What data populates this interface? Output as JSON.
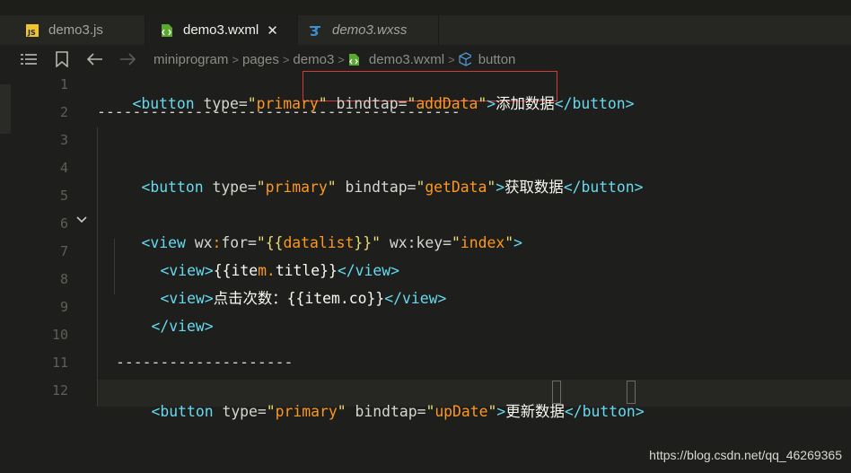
{
  "tabs": [
    {
      "label": "demo3.js",
      "icon": "js-file-icon",
      "active": false,
      "italic": false
    },
    {
      "label": "demo3.wxml",
      "icon": "wxml-file-icon",
      "active": true,
      "italic": false,
      "close": "✕"
    },
    {
      "label": "demo3.wxss",
      "icon": "css-file-icon",
      "active": false,
      "italic": true
    }
  ],
  "breadcrumb": [
    "miniprogram",
    "pages",
    "demo3",
    "demo3.wxml",
    "button"
  ],
  "line_numbers": [
    "1",
    "2",
    "3",
    "4",
    "5",
    "6",
    "7",
    "8",
    "9",
    "10",
    "11",
    "12"
  ],
  "code": {
    "l1": {
      "lt1": "<",
      "tag1": "button",
      "attr1": " type=",
      "q1": "\"",
      "val1": "primary",
      "q2": "\"",
      "attr2": " bindtap=",
      "q3": "\"",
      "val2": "addData",
      "q4": "\"",
      "gt1": ">",
      "text": "添加数据",
      "lt2": "</",
      "tag2": "button",
      "gt2": ">"
    },
    "l2": {
      "dashes": "-----------------------------------------"
    },
    "l4": {
      "lt1": "<",
      "tag1": "button",
      "attr1": " type=",
      "q1": "\"",
      "val1": "primary",
      "q2": "\"",
      "attr2": " bindtap=",
      "q3": "\"",
      "val2": "getData",
      "q4": "\"",
      "gt1": ">",
      "text": "获取数据",
      "lt2": "</",
      "tag2": "button",
      "gt2": ">"
    },
    "l6": {
      "lt1": "<",
      "tag1": "view",
      "attr1": " wx",
      "colon": ":",
      "attr1b": "for",
      "eq": "=",
      "q1": "\"",
      "val1a": "{{",
      "val1b": "datalist",
      "val1c": "}}",
      "q2": "\"",
      "attr2": " wx:key=",
      "q3": "\"",
      "val2": "index",
      "q4": "\"",
      "gt1": ">"
    },
    "l7": {
      "lt1": "<",
      "tag1": "view",
      "gt1": ">",
      "p1": "{{ite",
      "dot": "m.",
      "p2": "title}}",
      "lt2": "</",
      "tag2": "view",
      "gt2": ">"
    },
    "l8": {
      "lt1": "<",
      "tag1": "view",
      "gt1": ">",
      "text": "点击次数：",
      "p": "{{item.co}}",
      "lt2": "</",
      "tag2": "view",
      "gt2": ">"
    },
    "l9": {
      "lt": "</",
      "tag": "view",
      "gt": ">"
    },
    "l11": {
      "dashes": "--------------------"
    },
    "l12": {
      "lt1": "<",
      "tag1": "button",
      "attr1": " type=",
      "q1": "\"",
      "val1": "primary",
      "q2": "\"",
      "attr2": " bindtap=",
      "q3": "\"",
      "val2": "upDate",
      "q4": "\"",
      "gt1": ">",
      "text": "更新数据",
      "lt2": "</",
      "tag2": "button",
      "gt2": ">"
    }
  },
  "watermark": "https://blog.csdn.net/qq_46269365",
  "colors": {
    "tag": "#66d9ef",
    "string": "#e6db74",
    "accent": "#fd971f",
    "highlight": "#d33a3a"
  }
}
